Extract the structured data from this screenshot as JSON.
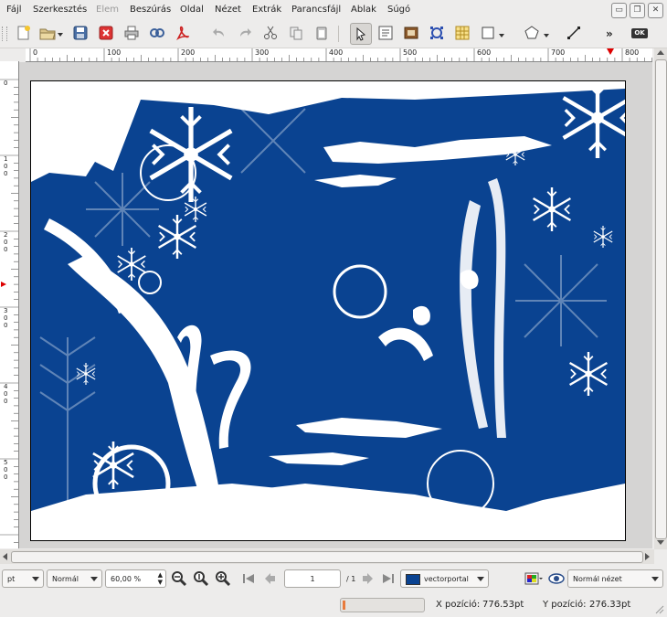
{
  "menubar": {
    "items": [
      {
        "label": "Fájl",
        "enabled": true
      },
      {
        "label": "Szerkesztés",
        "enabled": true
      },
      {
        "label": "Elem",
        "enabled": false
      },
      {
        "label": "Beszúrás",
        "enabled": true
      },
      {
        "label": "Oldal",
        "enabled": true
      },
      {
        "label": "Nézet",
        "enabled": true
      },
      {
        "label": "Extrák",
        "enabled": true
      },
      {
        "label": "Parancsfájl",
        "enabled": true
      },
      {
        "label": "Ablak",
        "enabled": true
      },
      {
        "label": "Súgó",
        "enabled": true
      }
    ]
  },
  "toolbar": {
    "tools": [
      "new-document-icon",
      "open-icon",
      "save-icon",
      "close-icon",
      "print-icon",
      "preflight-icon",
      "pdf-icon",
      "undo-icon",
      "redo-icon",
      "cut-icon",
      "copy-icon",
      "paste-icon",
      "select-icon",
      "text-frame-icon",
      "image-frame-icon",
      "render-frame-icon",
      "table-icon",
      "shape-icon",
      "polygon-icon",
      "line-icon"
    ],
    "overflow_label": "»",
    "ok_label": "OK"
  },
  "ruler": {
    "h_labels": [
      "0",
      "100",
      "200",
      "300",
      "400",
      "500",
      "600",
      "700",
      "800"
    ],
    "v_labels": [
      "0",
      "100",
      "200",
      "300",
      "400",
      "500"
    ]
  },
  "artwork": {
    "background_color": "#0a4391",
    "foreground_color": "#ffffff"
  },
  "statusbar": {
    "unit": "pt",
    "mode": "Normál",
    "zoom": "60,00 %",
    "page_number": "1",
    "page_total": "/ 1",
    "layer": "vectorportal",
    "layer_color": "#0a4391",
    "view_mode": "Normál nézet"
  },
  "coords": {
    "x_label": "X pozíció:",
    "x_value": "776.53pt",
    "y_label": "Y pozíció:",
    "y_value": "276.33pt"
  }
}
